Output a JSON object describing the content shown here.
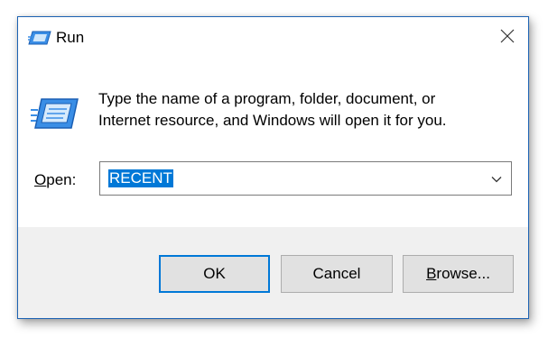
{
  "window": {
    "title": "Run"
  },
  "content": {
    "description_line1": "Type the name of a program, folder, document, or",
    "description_line2": "Internet resource, and Windows will open it for you."
  },
  "open_field": {
    "label_accel": "O",
    "label_rest": "pen:",
    "value": "RECENT",
    "selected": true
  },
  "buttons": {
    "ok": "OK",
    "cancel": "Cancel",
    "browse_accel": "B",
    "browse_rest": "rowse..."
  },
  "icons": {
    "title": "run-icon",
    "close": "close-icon",
    "content": "run-program-icon",
    "dropdown": "chevron-down-icon"
  },
  "colors": {
    "accent": "#0078d7",
    "window_border": "#1c62b3",
    "button_face": "#e1e1e1",
    "footer_bg": "#f0f0f0"
  }
}
